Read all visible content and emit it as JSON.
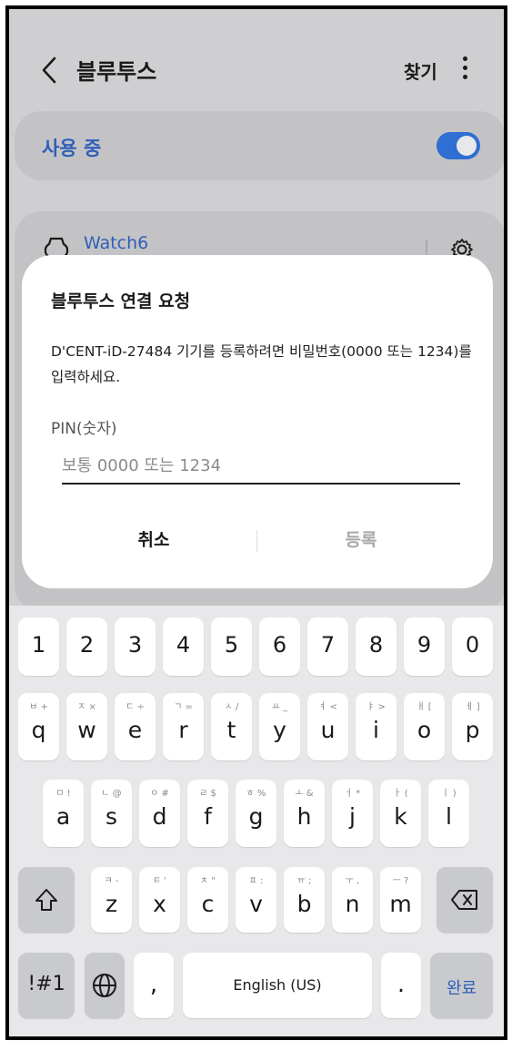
{
  "header": {
    "title": "블루투스",
    "find_label": "찾기"
  },
  "bluetooth_toggle": {
    "label": "사용 중",
    "on": true,
    "accent": "#2f6ed2"
  },
  "paired_device": {
    "name": "Watch6"
  },
  "dialog": {
    "title": "블루투스 연결 요청",
    "message": "D'CENT-iD-27484 기기를 등록하려면 비밀번호(0000 또는 1234)를 입력하세요.",
    "pin_label": "PIN(숫자)",
    "pin_placeholder": "보통 0000 또는 1234",
    "pin_value": "",
    "cancel_label": "취소",
    "register_label": "등록"
  },
  "keyboard": {
    "numbers": [
      "1",
      "2",
      "3",
      "4",
      "5",
      "6",
      "7",
      "8",
      "9",
      "0"
    ],
    "row1": [
      {
        "key": "q",
        "sub": "ㅂ  +"
      },
      {
        "key": "w",
        "sub": "ㅈ  ×"
      },
      {
        "key": "e",
        "sub": "ㄷ  ÷"
      },
      {
        "key": "r",
        "sub": "ㄱ  ="
      },
      {
        "key": "t",
        "sub": "ㅅ  /"
      },
      {
        "key": "y",
        "sub": "ㅛ  _"
      },
      {
        "key": "u",
        "sub": "ㅕ  <"
      },
      {
        "key": "i",
        "sub": "ㅑ  >"
      },
      {
        "key": "o",
        "sub": "ㅐ  ["
      },
      {
        "key": "p",
        "sub": "ㅔ  ]"
      }
    ],
    "row2": [
      {
        "key": "a",
        "sub": "ㅁ  !"
      },
      {
        "key": "s",
        "sub": "ㄴ  @"
      },
      {
        "key": "d",
        "sub": "ㅇ  #"
      },
      {
        "key": "f",
        "sub": "ㄹ  $"
      },
      {
        "key": "g",
        "sub": "ㅎ  %"
      },
      {
        "key": "h",
        "sub": "ㅗ  &"
      },
      {
        "key": "j",
        "sub": "ㅓ  *"
      },
      {
        "key": "k",
        "sub": "ㅏ  ("
      },
      {
        "key": "l",
        "sub": "ㅣ  )"
      }
    ],
    "row3": [
      {
        "key": "z",
        "sub": "ㅋ  -"
      },
      {
        "key": "x",
        "sub": "ㅌ  '"
      },
      {
        "key": "c",
        "sub": "ㅊ  \""
      },
      {
        "key": "v",
        "sub": "ㅍ  :"
      },
      {
        "key": "b",
        "sub": "ㅠ  ;"
      },
      {
        "key": "n",
        "sub": "ㅜ  ,"
      },
      {
        "key": "m",
        "sub": "ㅡ  ?"
      }
    ],
    "symbols_label": "!#1",
    "comma_label": ",",
    "space_label": "English (US)",
    "period_label": ".",
    "done_label": "완료",
    "done_color": "#2f5fb8"
  }
}
